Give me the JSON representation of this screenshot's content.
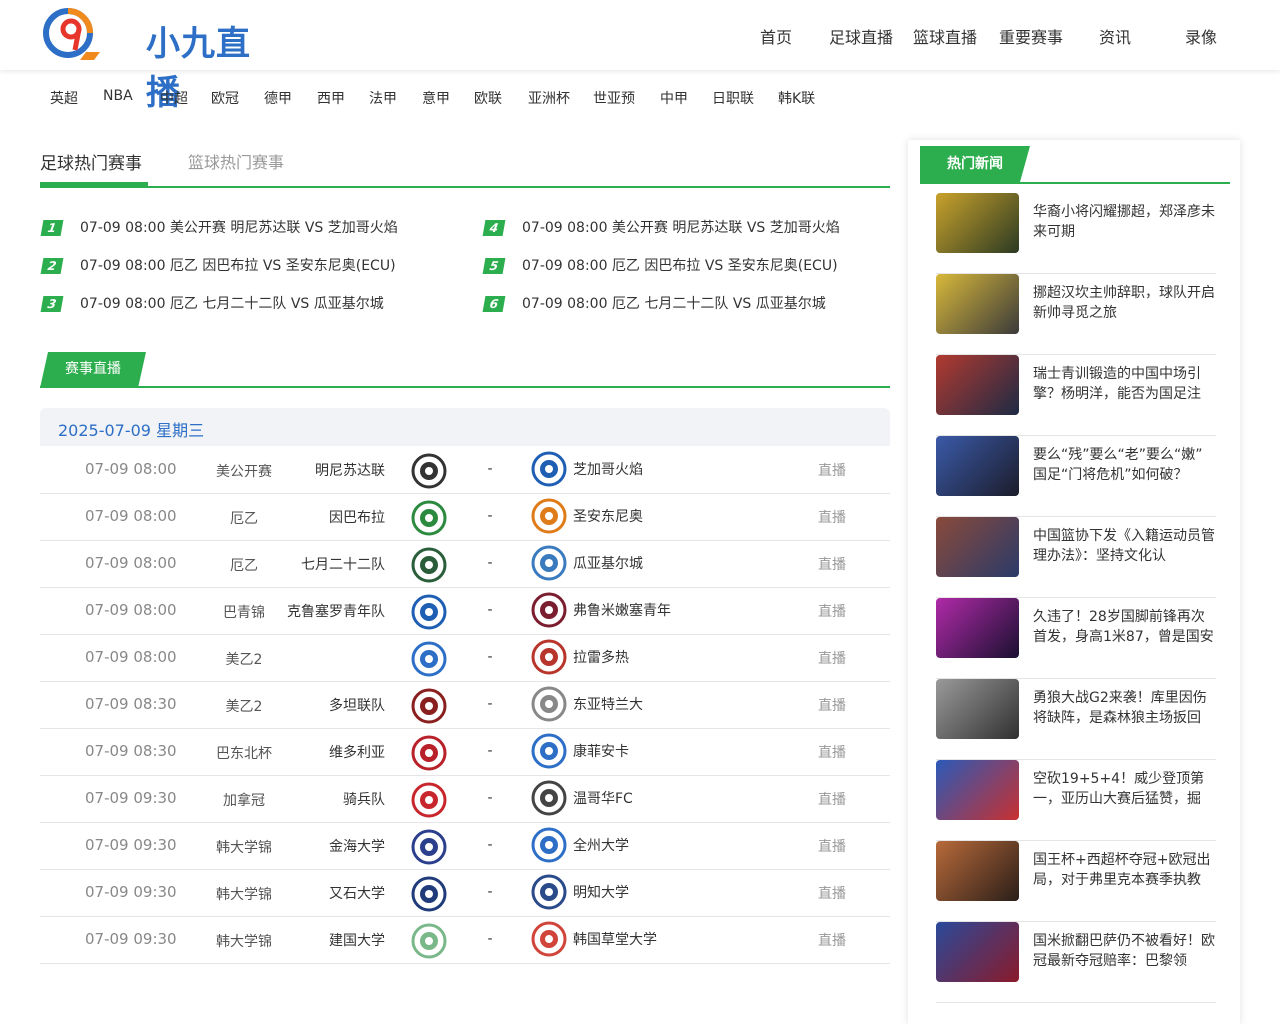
{
  "site": {
    "logo_text": "小九直播"
  },
  "nav": [
    "首页",
    "足球直播",
    "篮球直播",
    "重要赛事",
    "资讯",
    "录像"
  ],
  "leagues": [
    "英超",
    "NBA",
    "中超",
    "欧冠",
    "德甲",
    "西甲",
    "法甲",
    "意甲",
    "欧联",
    "亚洲杯",
    "世亚预",
    "中甲",
    "日职联",
    "韩K联"
  ],
  "hot_tabs": {
    "active": "足球热门赛事",
    "inactive": "篮球热门赛事"
  },
  "hot_matches": [
    {
      "num": "1",
      "text": "07-09 08:00 美公开赛 明尼苏达联 VS 芝加哥火焰"
    },
    {
      "num": "2",
      "text": "07-09 08:00 厄乙 因巴布拉 VS 圣安东尼奥(ECU)"
    },
    {
      "num": "3",
      "text": "07-09 08:00 厄乙 七月二十二队 VS 瓜亚基尔城"
    },
    {
      "num": "4",
      "text": "07-09 08:00 美公开赛 明尼苏达联 VS 芝加哥火焰"
    },
    {
      "num": "5",
      "text": "07-09 08:00 厄乙 因巴布拉 VS 圣安东尼奥(ECU)"
    },
    {
      "num": "6",
      "text": "07-09 08:00 厄乙 七月二十二队 VS 瓜亚基尔城"
    }
  ],
  "live": {
    "title": "赛事直播",
    "date": "2025-07-09 星期三"
  },
  "matches": [
    {
      "time": "07-09 08:00",
      "league": "美公开赛",
      "home": "明尼苏达联",
      "score": "-",
      "away": "芝加哥火焰",
      "live": "直播",
      "hcolor": "#333333",
      "acolor": "#1e5fb3"
    },
    {
      "time": "07-09 08:00",
      "league": "厄乙",
      "home": "因巴布拉",
      "score": "-",
      "away": "圣安东尼奥",
      "live": "直播",
      "hcolor": "#2b8a3e",
      "acolor": "#e07b1a"
    },
    {
      "time": "07-09 08:00",
      "league": "厄乙",
      "home": "七月二十二队",
      "score": "-",
      "away": "瓜亚基尔城",
      "live": "直播",
      "hcolor": "#2a5d3a",
      "acolor": "#3a7bbf"
    },
    {
      "time": "07-09 08:00",
      "league": "巴青锦",
      "home": "克鲁塞罗青年队",
      "score": "-",
      "away": "弗鲁米嫩塞青年",
      "live": "直播",
      "hcolor": "#1e5fb3",
      "acolor": "#7a1d2e"
    },
    {
      "time": "07-09 08:00",
      "league": "美乙2",
      "home": "",
      "score": "-",
      "away": "拉雷多热",
      "live": "直播",
      "hcolor": "#2d6fc6",
      "acolor": "#b8352b"
    },
    {
      "time": "07-09 08:30",
      "league": "美乙2",
      "home": "多坦联队",
      "score": "-",
      "away": "东亚特兰大",
      "live": "直播",
      "hcolor": "#8a1f1f",
      "acolor": "#888888"
    },
    {
      "time": "07-09 08:30",
      "league": "巴东北杯",
      "home": "维多利亚",
      "score": "-",
      "away": "康菲安卡",
      "live": "直播",
      "hcolor": "#b8212a",
      "acolor": "#2d6fc6"
    },
    {
      "time": "07-09 09:30",
      "league": "加拿冠",
      "home": "骑兵队",
      "score": "-",
      "away": "温哥华FC",
      "live": "直播",
      "hcolor": "#c8262d",
      "acolor": "#444444"
    },
    {
      "time": "07-09 09:30",
      "league": "韩大学锦",
      "home": "金海大学",
      "score": "-",
      "away": "全州大学",
      "live": "直播",
      "hcolor": "#2c3f8c",
      "acolor": "#2d6fc6"
    },
    {
      "time": "07-09 09:30",
      "league": "韩大学锦",
      "home": "又石大学",
      "score": "-",
      "away": "明知大学",
      "live": "直播",
      "hcolor": "#1f3b7a",
      "acolor": "#2a4a8a"
    },
    {
      "time": "07-09 09:30",
      "league": "韩大学锦",
      "home": "建国大学",
      "score": "-",
      "away": "韩国草堂大学",
      "live": "直播",
      "hcolor": "#7ab88a",
      "acolor": "#d0443a"
    }
  ],
  "sidebar": {
    "title": "热门新闻",
    "news": [
      {
        "text": "华裔小将闪耀挪超，郑泽彦未来可期",
        "c1": "#c9a22c",
        "c2": "#2b3a22"
      },
      {
        "text": "挪超汉坎主帅辞职，球队开启新帅寻觅之旅",
        "c1": "#d8b83a",
        "c2": "#3a3a3a"
      },
      {
        "text": "瑞士青训锻造的中国中场引擎？杨明洋，能否为国足注",
        "c1": "#b23a30",
        "c2": "#1d2a44"
      },
      {
        "text": "要么“残”要么“老”要么“嫩” 国足“门将危机”如何破？",
        "c1": "#3a5aa8",
        "c2": "#1c1c2a"
      },
      {
        "text": "中国篮协下发《入籍运动员管理办法》：坚持文化认",
        "c1": "#8a4a3a",
        "c2": "#2a3a6a"
      },
      {
        "text": "久违了！28岁国脚前锋再次首发，身高1米87，曾是国安",
        "c1": "#b02aa8",
        "c2": "#1a1030"
      },
      {
        "text": "勇狼大战G2来袭！库里因伤将缺阵，是森林狼主场扳回",
        "c1": "#9a9a9a",
        "c2": "#303030"
      },
      {
        "text": "空砍19+5+4！威少登顶第一，亚历山大赛后猛赞，掘",
        "c1": "#2a5ab8",
        "c2": "#c83030"
      },
      {
        "text": "国王杯+西超杯夺冠+欧冠出局，对于弗里克本赛季执教",
        "c1": "#b86a3a",
        "c2": "#2a1e18"
      },
      {
        "text": "国米掀翻巴萨仍不被看好！欧冠最新夺冠赔率：巴黎领",
        "c1": "#2a4a9a",
        "c2": "#8a1a2a"
      }
    ]
  }
}
